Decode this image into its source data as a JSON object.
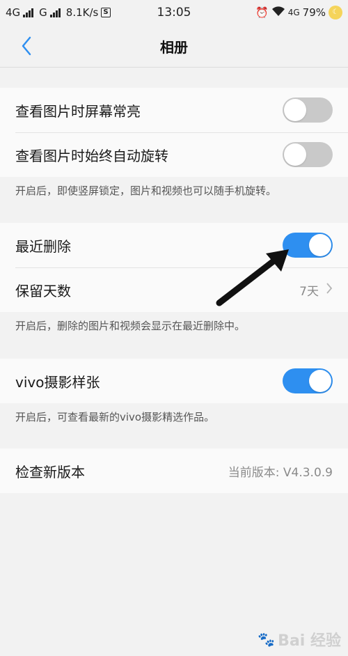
{
  "status_bar": {
    "left_text1": "4G",
    "left_text2": "G",
    "speed": "8.1K/s",
    "s_icon": "S",
    "time": "13:05",
    "network": "4G",
    "battery": "79%",
    "moon_text": "☾"
  },
  "nav": {
    "title": "相册"
  },
  "section1": {
    "row1_label": "查看图片时屏幕常亮",
    "row1_toggle": "off",
    "row2_label": "查看图片时始终自动旋转",
    "row2_toggle": "off",
    "hint": "开启后，即使竖屏锁定，图片和视频也可以随手机旋转。"
  },
  "section2": {
    "row1_label": "最近删除",
    "row1_toggle": "on",
    "row2_label": "保留天数",
    "row2_value": "7天",
    "hint": "开启后，删除的图片和视频会显示在最近删除中。"
  },
  "section3": {
    "row1_label": "vivo摄影样张",
    "row1_toggle": "on",
    "hint": "开启后，可查看最新的vivo摄影精选作品。"
  },
  "section4": {
    "row1_label": "检查新版本",
    "row1_value": "当前版本: V4.3.0.9"
  },
  "watermark": {
    "text": "Bai 经验"
  },
  "colors": {
    "accent": "#2e8ff0",
    "toggle_off": "#c9c9c9"
  }
}
